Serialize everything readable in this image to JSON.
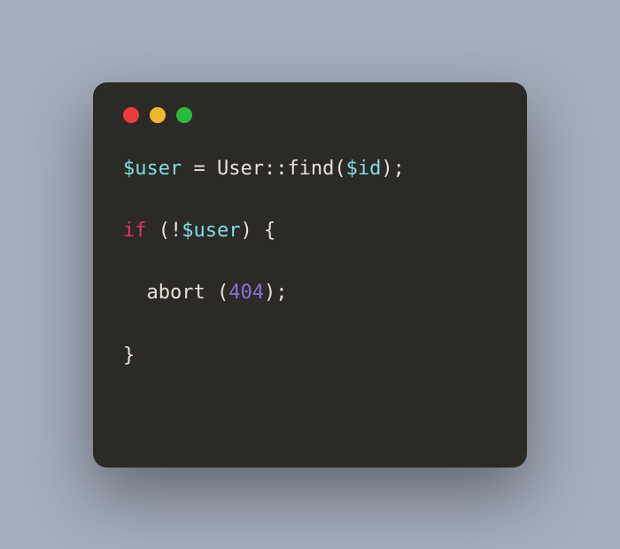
{
  "traffic_lights": {
    "close": "close-icon",
    "minimize": "minimize-icon",
    "maximize": "maximize-icon"
  },
  "code": {
    "line1": {
      "t1": "$user",
      "t2": " = User::find(",
      "t3": "$id",
      "t4": ");"
    },
    "line2": {
      "t1": "if",
      "t2": " (!",
      "t3": "$user",
      "t4": ") {"
    },
    "line3": {
      "t1": "  abort (",
      "t2": "404",
      "t3": ");"
    },
    "line4": {
      "t1": "}"
    }
  }
}
